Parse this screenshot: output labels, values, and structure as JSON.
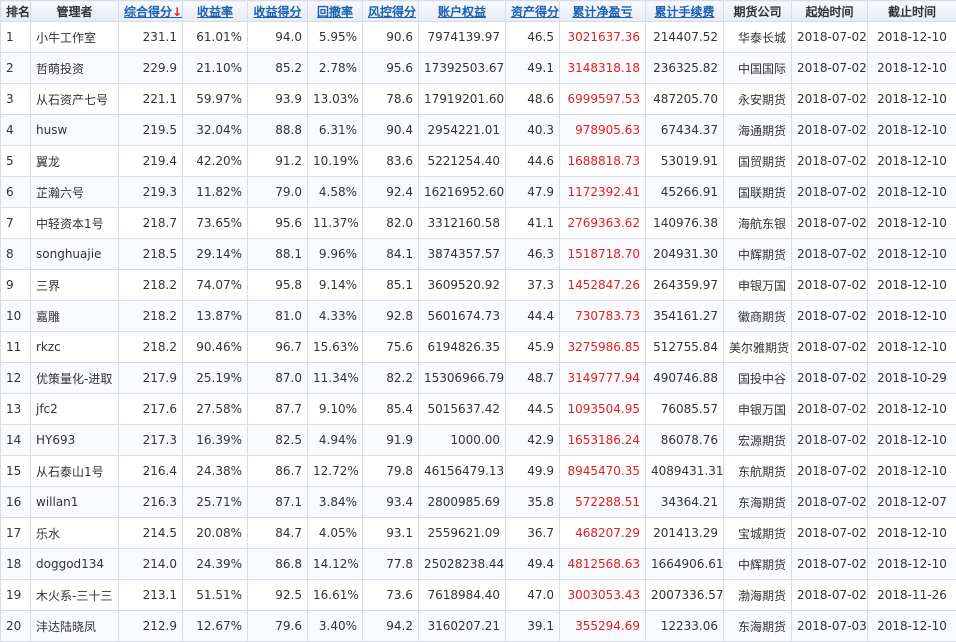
{
  "headers": {
    "rank": "排名",
    "manager": "管理者",
    "total_score": "综合得分",
    "sort_arrow": "↓",
    "return_rate": "收益率",
    "return_score": "收益得分",
    "drawdown": "回撤率",
    "risk_score": "风控得分",
    "equity": "账户权益",
    "asset_score": "资产得分",
    "net_pnl": "累计净盈亏",
    "fees": "累计手续费",
    "broker": "期货公司",
    "start": "起始时间",
    "end": "截止时间"
  },
  "colors": {
    "accent": "#1a5fb4",
    "loss_highlight": "#e02020",
    "border": "#d6dde8"
  },
  "rows": [
    {
      "rank": "1",
      "manager": "小牛工作室",
      "total_score": "231.1",
      "return_rate": "61.01%",
      "return_score": "94.0",
      "drawdown": "5.95%",
      "risk_score": "90.6",
      "equity": "7974139.97",
      "asset_score": "46.5",
      "net_pnl": "3021637.36",
      "fees": "214407.52",
      "broker": "华泰长城",
      "start": "2018-07-02",
      "end": "2018-12-10"
    },
    {
      "rank": "2",
      "manager": "哲萌投资",
      "total_score": "229.9",
      "return_rate": "21.10%",
      "return_score": "85.2",
      "drawdown": "2.78%",
      "risk_score": "95.6",
      "equity": "17392503.67",
      "asset_score": "49.1",
      "net_pnl": "3148318.18",
      "fees": "236325.82",
      "broker": "中国国际",
      "start": "2018-07-02",
      "end": "2018-12-10"
    },
    {
      "rank": "3",
      "manager": "从石资产七号",
      "total_score": "221.1",
      "return_rate": "59.97%",
      "return_score": "93.9",
      "drawdown": "13.03%",
      "risk_score": "78.6",
      "equity": "17919201.60",
      "asset_score": "48.6",
      "net_pnl": "6999597.53",
      "fees": "487205.70",
      "broker": "永安期货",
      "start": "2018-07-02",
      "end": "2018-12-10"
    },
    {
      "rank": "4",
      "manager": "husw",
      "total_score": "219.5",
      "return_rate": "32.04%",
      "return_score": "88.8",
      "drawdown": "6.31%",
      "risk_score": "90.4",
      "equity": "2954221.01",
      "asset_score": "40.3",
      "net_pnl": "978905.63",
      "fees": "67434.37",
      "broker": "海通期货",
      "start": "2018-07-02",
      "end": "2018-12-10"
    },
    {
      "rank": "5",
      "manager": "翼龙",
      "total_score": "219.4",
      "return_rate": "42.20%",
      "return_score": "91.2",
      "drawdown": "10.19%",
      "risk_score": "83.6",
      "equity": "5221254.40",
      "asset_score": "44.6",
      "net_pnl": "1688818.73",
      "fees": "53019.91",
      "broker": "国贸期货",
      "start": "2018-07-02",
      "end": "2018-12-10"
    },
    {
      "rank": "6",
      "manager": "芷瀚六号",
      "total_score": "219.3",
      "return_rate": "11.82%",
      "return_score": "79.0",
      "drawdown": "4.58%",
      "risk_score": "92.4",
      "equity": "16216952.60",
      "asset_score": "47.9",
      "net_pnl": "1172392.41",
      "fees": "45266.91",
      "broker": "国联期货",
      "start": "2018-07-02",
      "end": "2018-12-10"
    },
    {
      "rank": "7",
      "manager": "中轻资本1号",
      "total_score": "218.7",
      "return_rate": "73.65%",
      "return_score": "95.6",
      "drawdown": "11.37%",
      "risk_score": "82.0",
      "equity": "3312160.58",
      "asset_score": "41.1",
      "net_pnl": "2769363.62",
      "fees": "140976.38",
      "broker": "海航东银",
      "start": "2018-07-02",
      "end": "2018-12-10"
    },
    {
      "rank": "8",
      "manager": "songhuajie",
      "total_score": "218.5",
      "return_rate": "29.14%",
      "return_score": "88.1",
      "drawdown": "9.96%",
      "risk_score": "84.1",
      "equity": "3874357.57",
      "asset_score": "46.3",
      "net_pnl": "1518718.70",
      "fees": "204931.30",
      "broker": "中辉期货",
      "start": "2018-07-02",
      "end": "2018-12-10"
    },
    {
      "rank": "9",
      "manager": "三界",
      "total_score": "218.2",
      "return_rate": "74.07%",
      "return_score": "95.8",
      "drawdown": "9.14%",
      "risk_score": "85.1",
      "equity": "3609520.92",
      "asset_score": "37.3",
      "net_pnl": "1452847.26",
      "fees": "264359.97",
      "broker": "申银万国",
      "start": "2018-07-02",
      "end": "2018-12-10"
    },
    {
      "rank": "10",
      "manager": "嘉雕",
      "total_score": "218.2",
      "return_rate": "13.87%",
      "return_score": "81.0",
      "drawdown": "4.33%",
      "risk_score": "92.8",
      "equity": "5601674.73",
      "asset_score": "44.4",
      "net_pnl": "730783.73",
      "fees": "354161.27",
      "broker": "徽商期货",
      "start": "2018-07-02",
      "end": "2018-12-10"
    },
    {
      "rank": "11",
      "manager": "rkzc",
      "total_score": "218.2",
      "return_rate": "90.46%",
      "return_score": "96.7",
      "drawdown": "15.63%",
      "risk_score": "75.6",
      "equity": "6194826.35",
      "asset_score": "45.9",
      "net_pnl": "3275986.85",
      "fees": "512755.84",
      "broker": "美尔雅期货",
      "start": "2018-07-02",
      "end": "2018-12-10"
    },
    {
      "rank": "12",
      "manager": "优策量化-进取",
      "total_score": "217.9",
      "return_rate": "25.19%",
      "return_score": "87.0",
      "drawdown": "11.34%",
      "risk_score": "82.2",
      "equity": "15306966.79",
      "asset_score": "48.7",
      "net_pnl": "3149777.94",
      "fees": "490746.88",
      "broker": "国投中谷",
      "start": "2018-07-02",
      "end": "2018-10-29"
    },
    {
      "rank": "13",
      "manager": "jfc2",
      "total_score": "217.6",
      "return_rate": "27.58%",
      "return_score": "87.7",
      "drawdown": "9.10%",
      "risk_score": "85.4",
      "equity": "5015637.42",
      "asset_score": "44.5",
      "net_pnl": "1093504.95",
      "fees": "76085.57",
      "broker": "申银万国",
      "start": "2018-07-02",
      "end": "2018-12-10"
    },
    {
      "rank": "14",
      "manager": "HY693",
      "total_score": "217.3",
      "return_rate": "16.39%",
      "return_score": "82.5",
      "drawdown": "4.94%",
      "risk_score": "91.9",
      "equity": "1000.00",
      "asset_score": "42.9",
      "net_pnl": "1653186.24",
      "fees": "86078.76",
      "broker": "宏源期货",
      "start": "2018-07-02",
      "end": "2018-12-10"
    },
    {
      "rank": "15",
      "manager": "从石泰山1号",
      "total_score": "216.4",
      "return_rate": "24.38%",
      "return_score": "86.7",
      "drawdown": "12.72%",
      "risk_score": "79.8",
      "equity": "46156479.13",
      "asset_score": "49.9",
      "net_pnl": "8945470.35",
      "fees": "4089431.31",
      "broker": "东航期货",
      "start": "2018-07-02",
      "end": "2018-12-10"
    },
    {
      "rank": "16",
      "manager": "willan1",
      "total_score": "216.3",
      "return_rate": "25.71%",
      "return_score": "87.1",
      "drawdown": "3.84%",
      "risk_score": "93.4",
      "equity": "2800985.69",
      "asset_score": "35.8",
      "net_pnl": "572288.51",
      "fees": "34364.21",
      "broker": "东海期货",
      "start": "2018-07-02",
      "end": "2018-12-07"
    },
    {
      "rank": "17",
      "manager": "乐水",
      "total_score": "214.5",
      "return_rate": "20.08%",
      "return_score": "84.7",
      "drawdown": "4.05%",
      "risk_score": "93.1",
      "equity": "2559621.09",
      "asset_score": "36.7",
      "net_pnl": "468207.29",
      "fees": "201413.29",
      "broker": "宝城期货",
      "start": "2018-07-02",
      "end": "2018-12-10"
    },
    {
      "rank": "18",
      "manager": "doggod134",
      "total_score": "214.0",
      "return_rate": "24.39%",
      "return_score": "86.8",
      "drawdown": "14.12%",
      "risk_score": "77.8",
      "equity": "25028238.44",
      "asset_score": "49.4",
      "net_pnl": "4812568.63",
      "fees": "1664906.61",
      "broker": "中辉期货",
      "start": "2018-07-02",
      "end": "2018-12-10"
    },
    {
      "rank": "19",
      "manager": "木火系-三十三",
      "total_score": "213.1",
      "return_rate": "51.51%",
      "return_score": "92.5",
      "drawdown": "16.61%",
      "risk_score": "73.6",
      "equity": "7618984.40",
      "asset_score": "47.0",
      "net_pnl": "3003053.43",
      "fees": "2007336.57",
      "broker": "渤海期货",
      "start": "2018-07-02",
      "end": "2018-11-26"
    },
    {
      "rank": "20",
      "manager": "沣达陆晓凤",
      "total_score": "212.9",
      "return_rate": "12.67%",
      "return_score": "79.6",
      "drawdown": "3.40%",
      "risk_score": "94.2",
      "equity": "3160207.21",
      "asset_score": "39.1",
      "net_pnl": "355294.69",
      "fees": "12233.06",
      "broker": "东海期货",
      "start": "2018-07-03",
      "end": "2018-12-10"
    }
  ]
}
